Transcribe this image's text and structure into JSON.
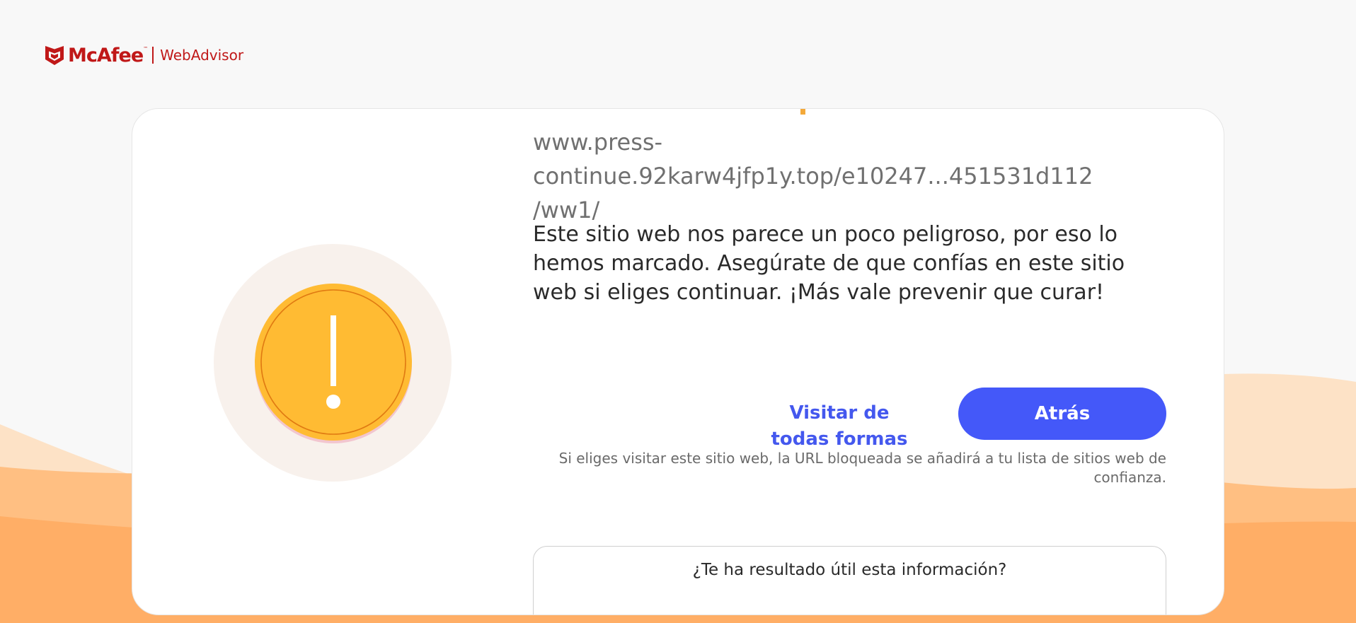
{
  "header": {
    "brand_name": "McAfee",
    "brand_tm": "™",
    "product_name": "WebAdvisor",
    "brand_color": "#c01818"
  },
  "warning": {
    "icon": "exclamation-warning-icon",
    "url": "www.press-continue.92karw4jfp1y.top/e10247...451531d112 /ww1/",
    "message": "Este sitio web nos parece un poco peligroso, por eso lo hemos marcado. Asegúrate de que confías en este sitio web si eliges continuar. ¡Más vale prevenir que curar!",
    "accent_color": "#ffbb33"
  },
  "actions": {
    "visit_label": "Visitar de todas formas",
    "back_label": "Atrás",
    "note": "Si eliges visitar este sitio web, la URL bloqueada se añadirá a tu lista de sitios web de confianza.",
    "primary_color": "#4458f9",
    "link_color": "#4458ee"
  },
  "feedback": {
    "question": "¿Te ha resultado útil esta información?"
  }
}
